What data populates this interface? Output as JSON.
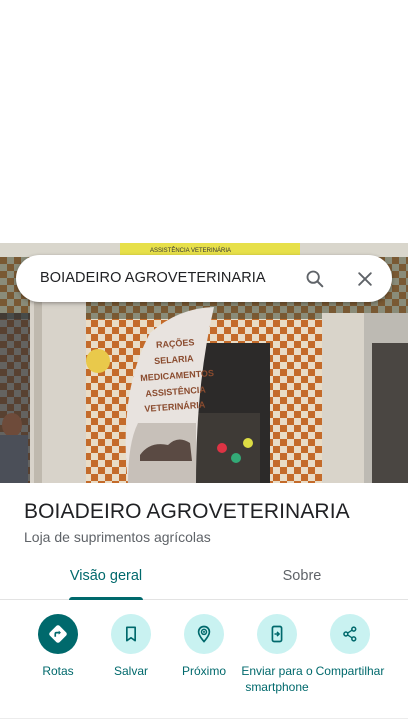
{
  "search": {
    "query": "BOIADEIRO AGROVETERINARIA",
    "search_icon": "search-icon",
    "close_icon": "close-icon"
  },
  "photo": {
    "banner_top": "ASSISTÊNCIA VETERINÁRIA",
    "flag_lines": [
      "RAÇÕES",
      "SELARIA",
      "MEDICAMENTOS",
      "ASSISTÊNCIA",
      "VETERINÁRIA"
    ]
  },
  "place": {
    "name": "BOIADEIRO AGROVETERINARIA",
    "category": "Loja de suprimentos agrícolas"
  },
  "tabs": [
    {
      "label": "Visão geral",
      "selected": true
    },
    {
      "label": "Sobre",
      "selected": false
    }
  ],
  "actions": [
    {
      "label": "Rotas",
      "icon": "directions-icon"
    },
    {
      "label": "Salvar",
      "icon": "bookmark-icon"
    },
    {
      "label": "Próximo",
      "icon": "nearby-icon"
    },
    {
      "label": "Enviar para o smartphone",
      "icon": "send-to-phone-icon"
    },
    {
      "label": "Compartilhar",
      "icon": "share-icon"
    }
  ],
  "colors": {
    "accent": "#00696c",
    "accent_light": "#c9f2f1",
    "text": "#202124",
    "subtext": "#5f6368"
  }
}
